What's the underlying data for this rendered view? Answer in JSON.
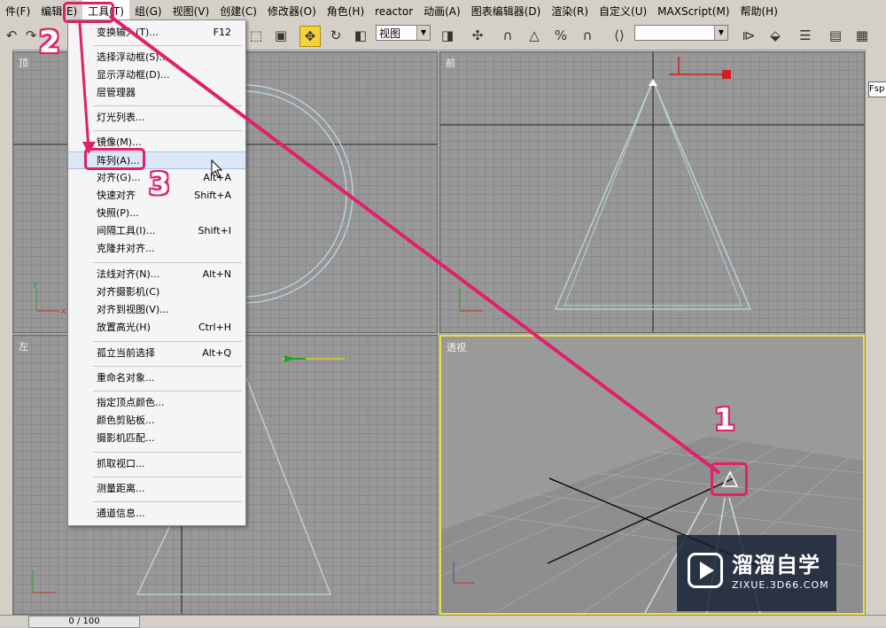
{
  "menubar": {
    "items": [
      "件(F)",
      "编辑(E)",
      "工具(T)",
      "组(G)",
      "视图(V)",
      "创建(C)",
      "修改器(O)",
      "角色(H)",
      "reactor",
      "动画(A)",
      "图表编辑器(D)",
      "渲染(R)",
      "自定义(U)",
      "MAXScript(M)",
      "帮助(H)"
    ],
    "active_index": 2
  },
  "toolbar": {
    "view_select": "视图",
    "empty_select": ""
  },
  "viewports": {
    "top": "顶",
    "front": "前",
    "left": "左",
    "perspective": "透视"
  },
  "axis": {
    "x": "x",
    "y": "y",
    "z": "z"
  },
  "tools_menu": {
    "items": [
      {
        "label": "变换输入(T)...",
        "shortcut": "F12"
      },
      {
        "label": "选择浮动框(S)...",
        "shortcut": ""
      },
      {
        "label": "显示浮动框(D)...",
        "shortcut": ""
      },
      {
        "label": "层管理器",
        "shortcut": ""
      },
      {
        "label": "灯光列表...",
        "shortcut": ""
      },
      {
        "label": "镜像(M)...",
        "shortcut": ""
      },
      {
        "label": "阵列(A)...",
        "shortcut": ""
      },
      {
        "label": "对齐(G)...",
        "shortcut": "Alt+A"
      },
      {
        "label": "快速对齐",
        "shortcut": "Shift+A"
      },
      {
        "label": "快照(P)...",
        "shortcut": ""
      },
      {
        "label": "间隔工具(I)...",
        "shortcut": "Shift+I"
      },
      {
        "label": "克隆并对齐...",
        "shortcut": ""
      },
      {
        "label": "法线对齐(N)...",
        "shortcut": "Alt+N"
      },
      {
        "label": "对齐摄影机(C)",
        "shortcut": ""
      },
      {
        "label": "对齐到视图(V)...",
        "shortcut": ""
      },
      {
        "label": "放置高光(H)",
        "shortcut": "Ctrl+H"
      },
      {
        "label": "孤立当前选择",
        "shortcut": "Alt+Q"
      },
      {
        "label": "重命名对象...",
        "shortcut": ""
      },
      {
        "label": "指定顶点颜色...",
        "shortcut": ""
      },
      {
        "label": "颜色剪贴板...",
        "shortcut": ""
      },
      {
        "label": "摄影机匹配...",
        "shortcut": ""
      },
      {
        "label": "抓取视口...",
        "shortcut": ""
      },
      {
        "label": "测量距离...",
        "shortcut": ""
      },
      {
        "label": "通道信息...",
        "shortcut": ""
      }
    ],
    "highlighted_index": 6
  },
  "annotations": {
    "step1": "1",
    "step2": "2",
    "step3": "3",
    "color": "#e0206a"
  },
  "right_panel": {
    "field": "Fsp"
  },
  "statusbar": {
    "frame_counter": "0 / 100"
  },
  "watermark": {
    "title": "溜溜自学",
    "url": "ZIXUE.3D66.COM"
  }
}
